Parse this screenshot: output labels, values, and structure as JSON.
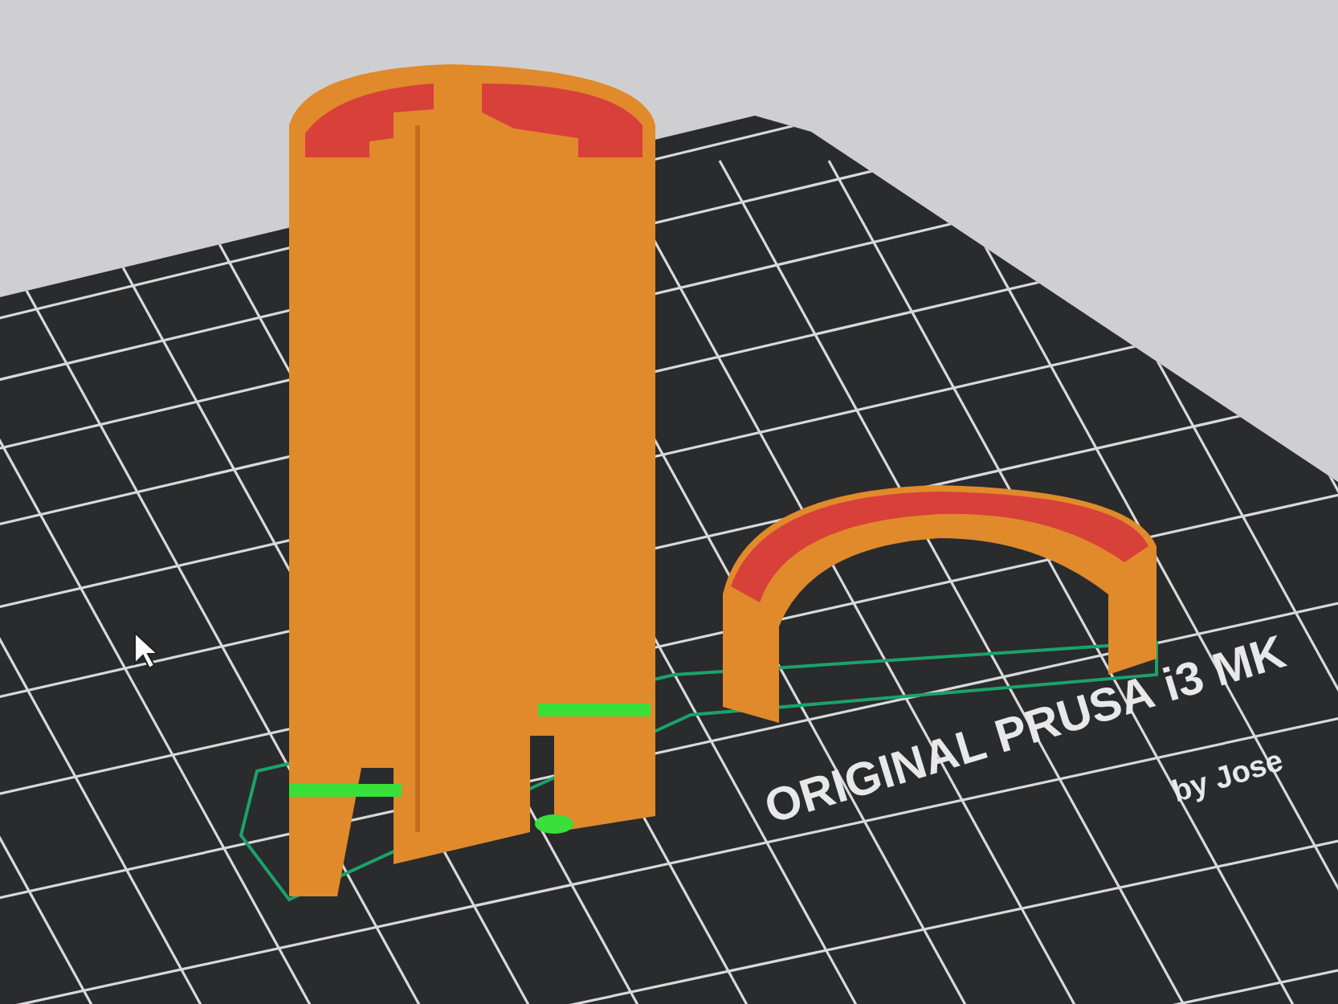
{
  "bed_label": {
    "title": "ORIGINAL PRUSA i3 MK",
    "subtitle": "by Jose"
  }
}
